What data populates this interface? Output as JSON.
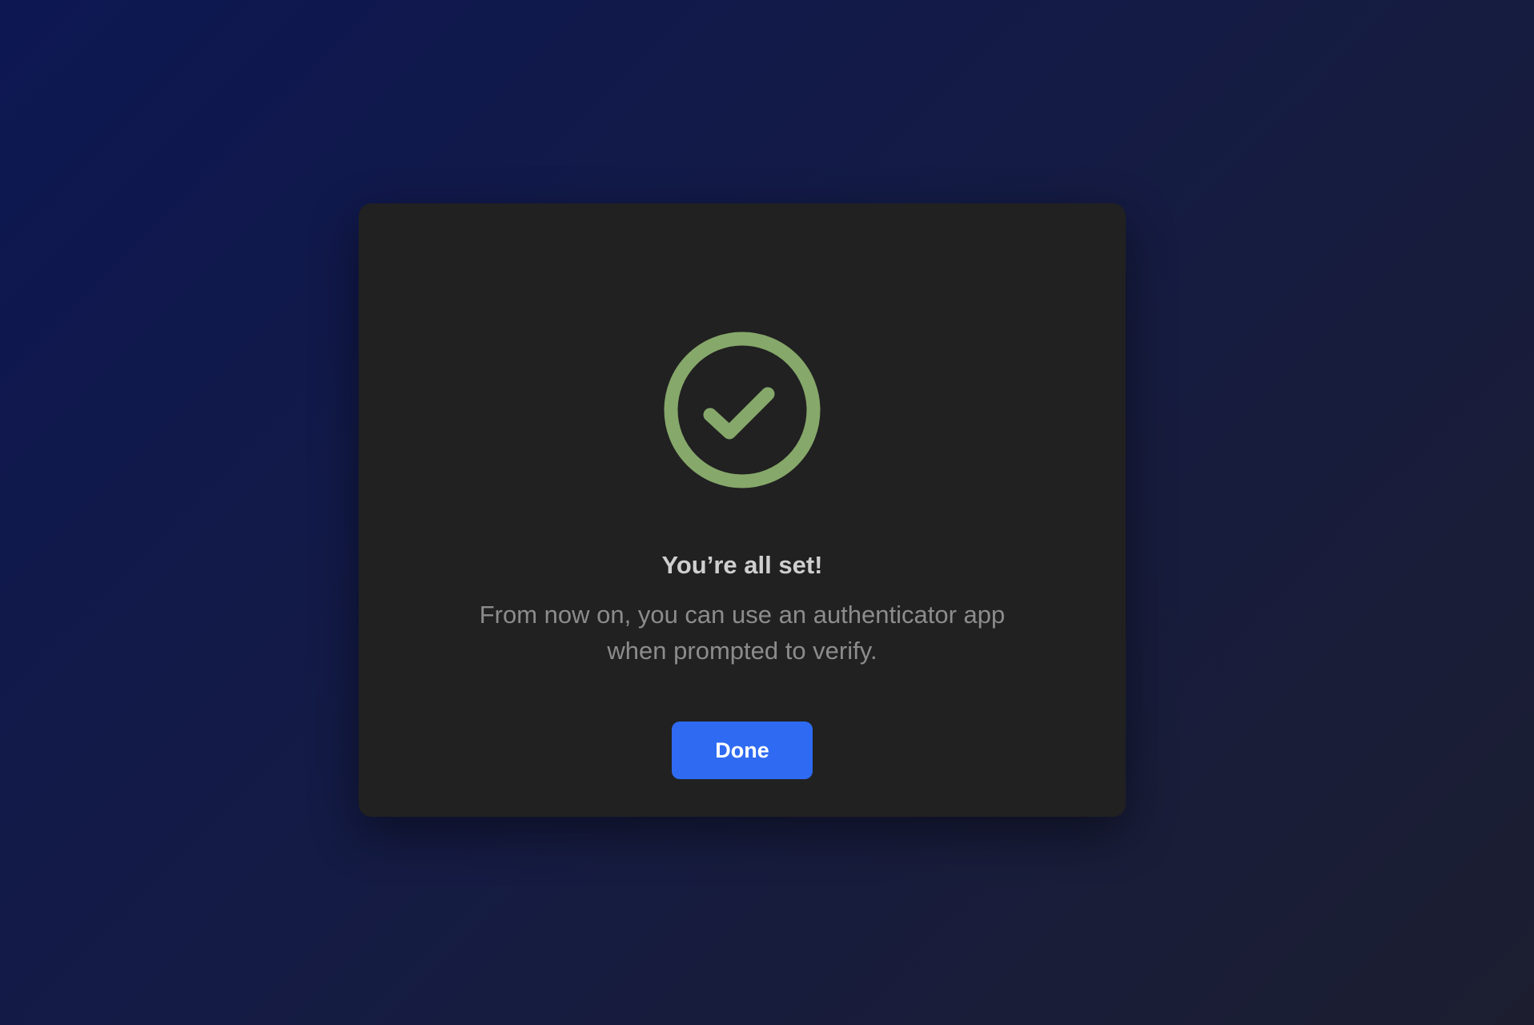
{
  "dialog": {
    "icon": "check-circle-icon",
    "title": "You’re all set!",
    "message": "From now on, you can use an authenticator app when prompted to verify.",
    "done_label": "Done"
  },
  "colors": {
    "background_start": "#0d1752",
    "background_end": "#1c1e30",
    "dialog_background": "#212121",
    "success_green": "#86a86a",
    "title_text": "#cfcfcf",
    "body_text": "#8c8c8c",
    "primary_button": "#2f6bf2"
  }
}
